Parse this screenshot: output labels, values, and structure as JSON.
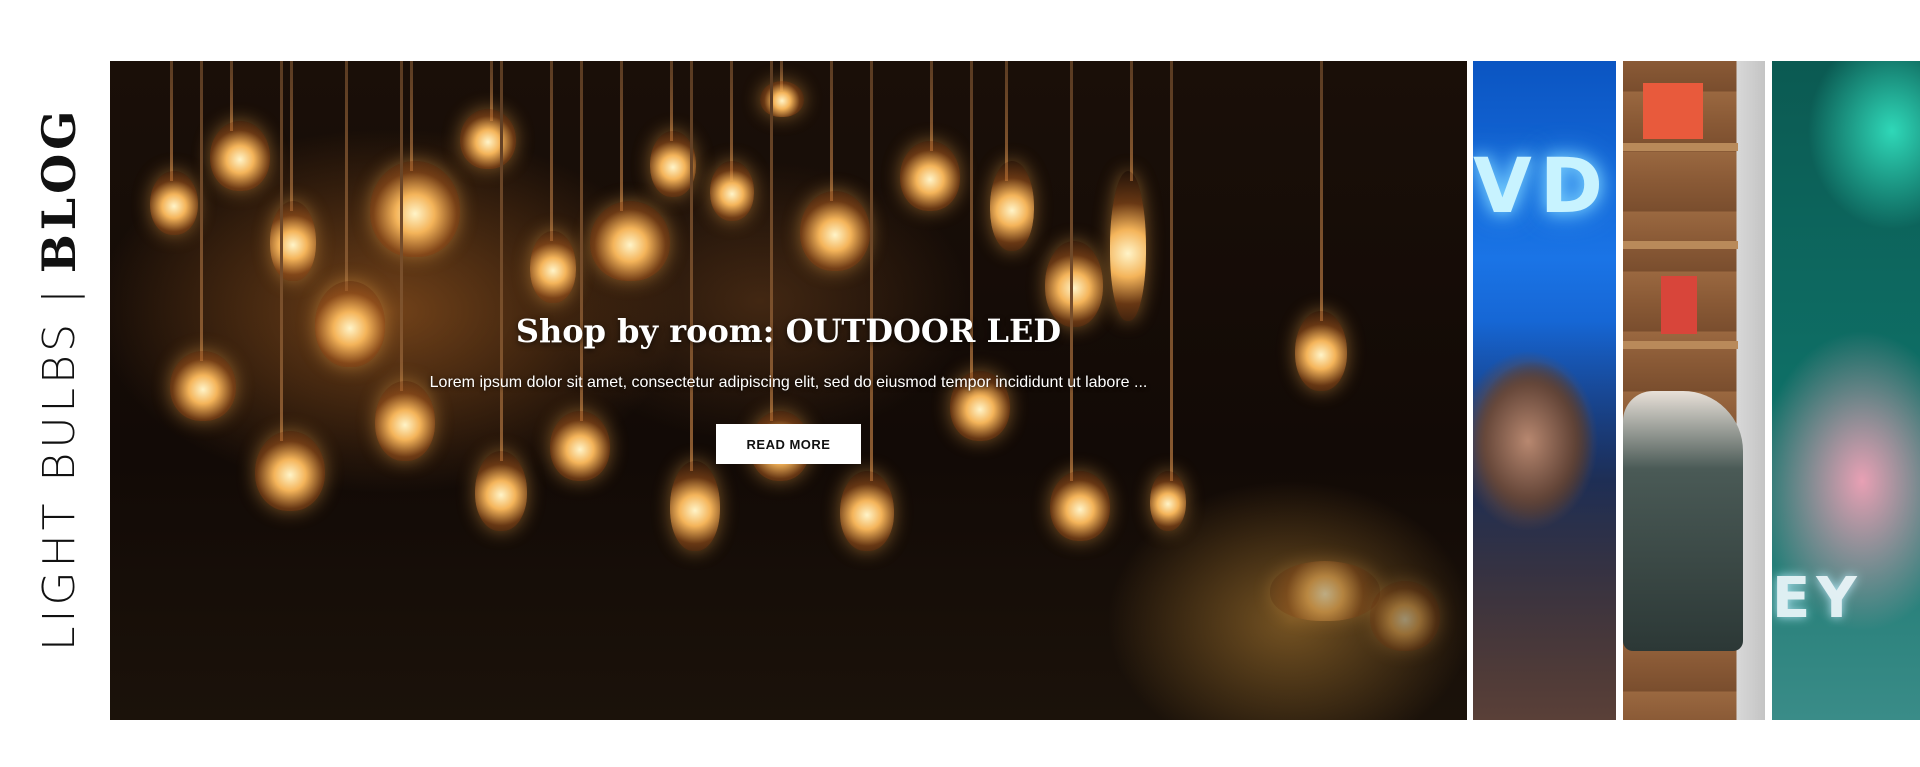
{
  "section": {
    "title_light": "LIGHT BULBS",
    "separator": "|",
    "title_bold": "BLOG"
  },
  "slider": {
    "main": {
      "title": "Shop by room: OUTDOOR LED",
      "excerpt": "Lorem ipsum dolor sit amet, consectetur adipiscing elit, sed do eiusmod tempor incididunt ut labore ...",
      "button_label": "READ MORE"
    },
    "thumbs": [
      {
        "image": "woman-neon-sign-photo",
        "visible_text": "VD"
      },
      {
        "image": "person-reading-on-shelf-photo"
      },
      {
        "image": "teal-pink-neon-photo",
        "visible_text": "EY"
      }
    ]
  },
  "colors": {
    "background": "#ffffff",
    "title_text": "#111111",
    "overlay_text": "#ffffff",
    "button_bg": "#ffffff"
  }
}
